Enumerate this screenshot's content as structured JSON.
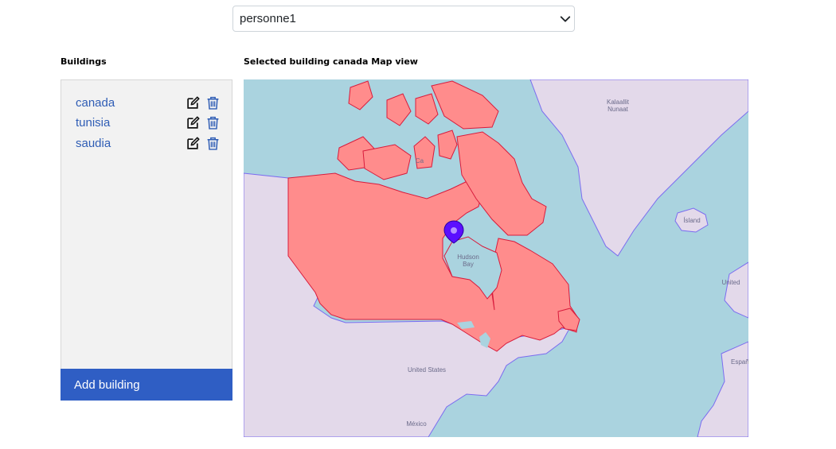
{
  "user_select": {
    "value": "personne1"
  },
  "buildings_title": "Buildings",
  "buildings": [
    {
      "label": "canada"
    },
    {
      "label": "tunisia"
    },
    {
      "label": "saudia"
    }
  ],
  "add_building_label": "Add building",
  "map_title": "Selected building canada Map view",
  "map": {
    "labels": {
      "greenland": "Kalaallit\nNunaat",
      "iceland": "Ísland",
      "hudson_bay": "Hudson\nBay",
      "usa": "United States",
      "mexico": "México",
      "uk": "United",
      "spain": "Españ",
      "canada_short": "Ca"
    },
    "colors": {
      "water": "#aad3df",
      "land": "#e3d9ea",
      "highlight_fill": "#ff8c8c",
      "highlight_stroke": "#d81b3c",
      "border": "#7b6cf0",
      "marker": "#5b0fff"
    }
  }
}
